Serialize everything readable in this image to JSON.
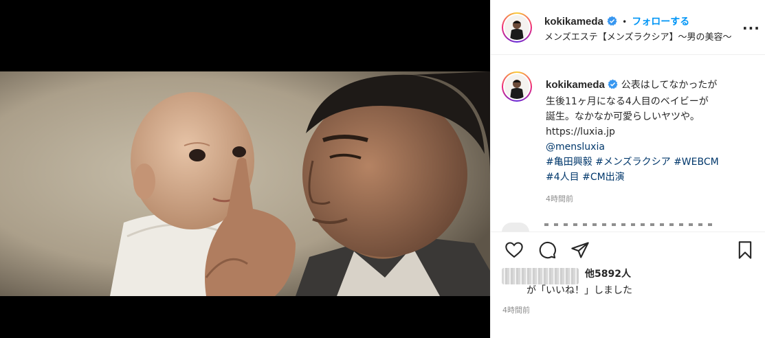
{
  "post": {
    "username": "kokikameda",
    "separator": "•",
    "follow_label": "フォローする",
    "location": "メンズエステ【メンズラクシア】〜男の美容〜",
    "more_label": "...",
    "caption": {
      "username": "kokikameda",
      "line1": "公表はしてなかったが",
      "line2": "生後11ヶ月になる4人目のベイビーが",
      "line3": "誕生。なかなか可愛らしいヤツや。",
      "url": "https://luxia.jp",
      "mention": "@mensluxia",
      "hashtags_line1": "#亀田興毅 #メンズラクシア #WEBCM",
      "hashtags_line2": "#4人目 #CM出演"
    },
    "caption_time": "4時間前",
    "likes_count": "他5892人",
    "liked_suffix": "が「いいね！」しました",
    "post_time": "4時間前"
  },
  "icons": [
    "verified-badge-icon",
    "heart-icon",
    "comment-icon",
    "share-icon",
    "bookmark-icon",
    "more-options-icon"
  ],
  "colors": {
    "follow": "#0095f6",
    "link": "#00376b",
    "timestamp": "#8e8e8e",
    "verified": "#3897f0"
  }
}
